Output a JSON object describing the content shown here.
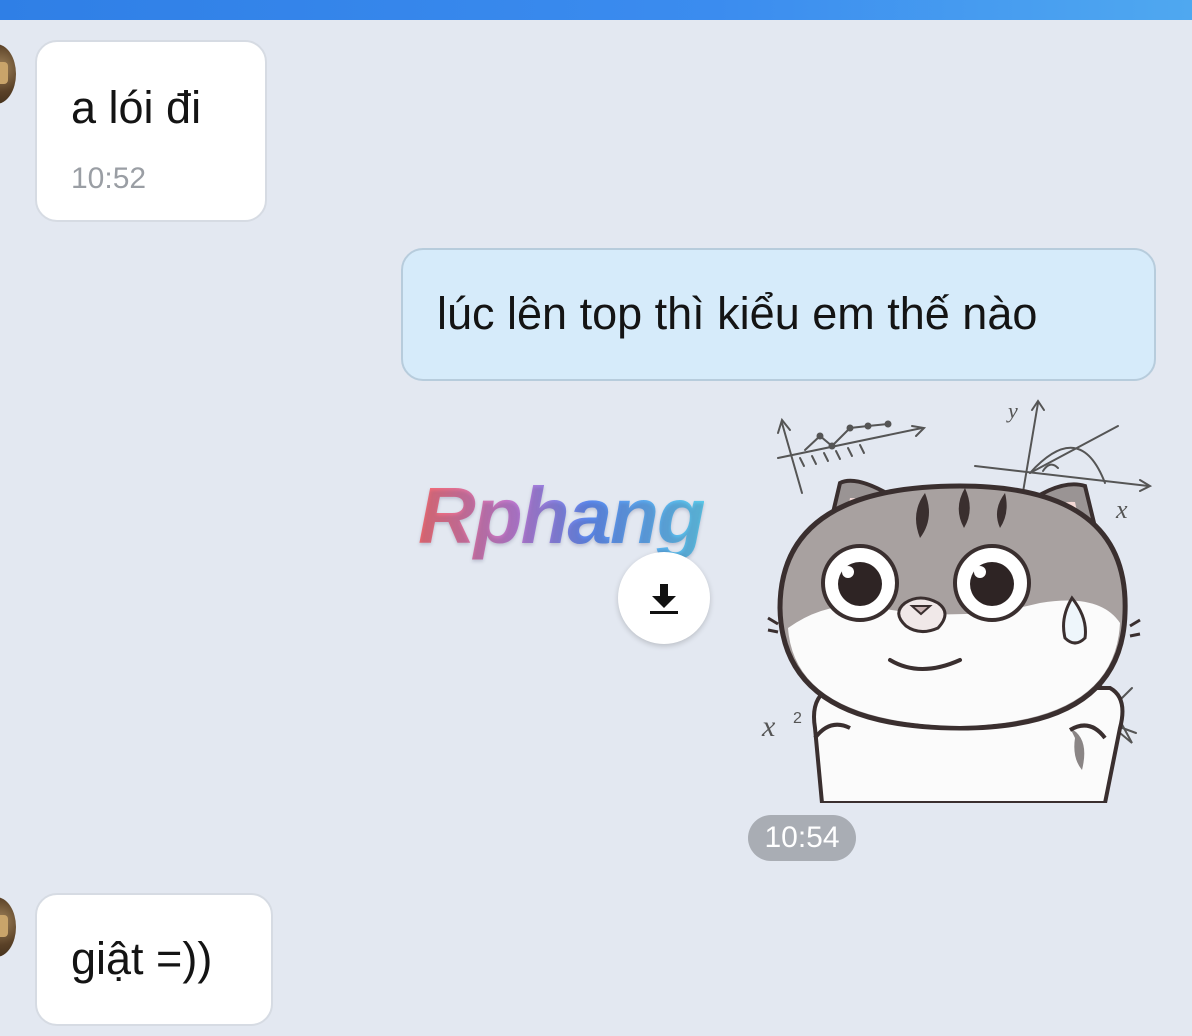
{
  "messages": [
    {
      "direction": "incoming",
      "text": "a lói đi",
      "time": "10:52"
    },
    {
      "direction": "outgoing",
      "text": "lúc lên top thì kiểu em thế nào"
    },
    {
      "direction": "outgoing",
      "type": "sticker",
      "watermark": "Rphang",
      "time": "10:54",
      "icon": "download-icon"
    },
    {
      "direction": "incoming",
      "text": "giật =))"
    }
  ],
  "colors": {
    "background": "#e3e8f1",
    "incoming_bubble": "#ffffff",
    "outgoing_bubble": "#d6ebfa",
    "top_bar": "#3b8cef"
  }
}
